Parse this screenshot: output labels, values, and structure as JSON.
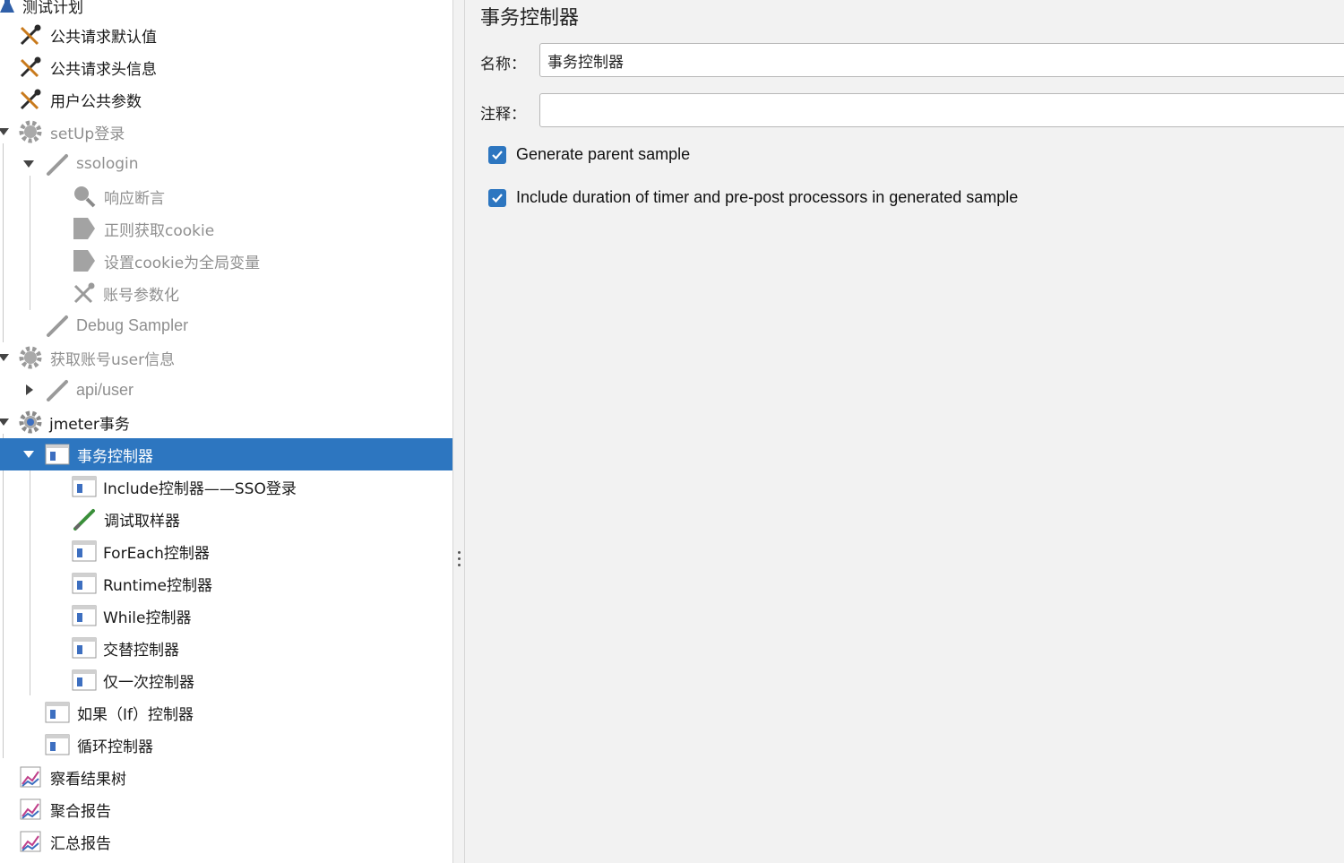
{
  "tree": {
    "items": [
      {
        "label": "测试计划",
        "icon": "flask-icon",
        "disabled": false
      },
      {
        "label": "公共请求默认值",
        "icon": "tools-icon",
        "disabled": false
      },
      {
        "label": "公共请求头信息",
        "icon": "tools-icon",
        "disabled": false
      },
      {
        "label": "用户公共参数",
        "icon": "tools-icon",
        "disabled": false
      },
      {
        "label": "setUp登录",
        "icon": "gear-icon",
        "disabled": true
      },
      {
        "label": "ssologin",
        "icon": "pipette-icon",
        "disabled": true
      },
      {
        "label": "响应断言",
        "icon": "magnifier-icon",
        "disabled": true
      },
      {
        "label": "正则获取cookie",
        "icon": "tag-icon",
        "disabled": true
      },
      {
        "label": "设置cookie为全局变量",
        "icon": "tag-icon",
        "disabled": true
      },
      {
        "label": "账号参数化",
        "icon": "tools-icon",
        "disabled": true
      },
      {
        "label": "Debug Sampler",
        "icon": "pipette-icon",
        "disabled": true
      },
      {
        "label": "获取账号user信息",
        "icon": "gear-icon",
        "disabled": true
      },
      {
        "label": "api/user",
        "icon": "pipette-icon",
        "disabled": true
      },
      {
        "label": "jmeter事务",
        "icon": "gear-icon",
        "disabled": false
      },
      {
        "label": "事务控制器",
        "icon": "controller-icon",
        "disabled": false,
        "selected": true
      },
      {
        "label": "Include控制器——SSO登录",
        "icon": "controller-icon",
        "disabled": false
      },
      {
        "label": "调试取样器",
        "icon": "pipette-icon",
        "disabled": false
      },
      {
        "label": "ForEach控制器",
        "icon": "controller-icon",
        "disabled": false
      },
      {
        "label": "Runtime控制器",
        "icon": "controller-icon",
        "disabled": false
      },
      {
        "label": "While控制器",
        "icon": "controller-icon",
        "disabled": false
      },
      {
        "label": "交替控制器",
        "icon": "controller-icon",
        "disabled": false
      },
      {
        "label": "仅一次控制器",
        "icon": "controller-icon",
        "disabled": false
      },
      {
        "label": "如果（If）控制器",
        "icon": "controller-icon",
        "disabled": false
      },
      {
        "label": "循环控制器",
        "icon": "controller-icon",
        "disabled": false
      },
      {
        "label": "察看结果树",
        "icon": "graph-icon",
        "disabled": false
      },
      {
        "label": "聚合报告",
        "icon": "graph-icon",
        "disabled": false
      },
      {
        "label": "汇总报告",
        "icon": "graph-icon",
        "disabled": false
      }
    ]
  },
  "panel": {
    "title": "事务控制器",
    "name_label": "名称：",
    "name_value": "事务控制器",
    "comment_label": "注释：",
    "comment_value": "",
    "checkbox_generate_parent": {
      "label": "Generate parent sample",
      "checked": true
    },
    "checkbox_include_duration": {
      "label": "Include duration of timer and pre-post processors in generated sample",
      "checked": true
    }
  },
  "colors": {
    "selection": "#2d76c0",
    "panel_bg": "#f2f2f2",
    "disabled_text": "#8f8f8f"
  }
}
